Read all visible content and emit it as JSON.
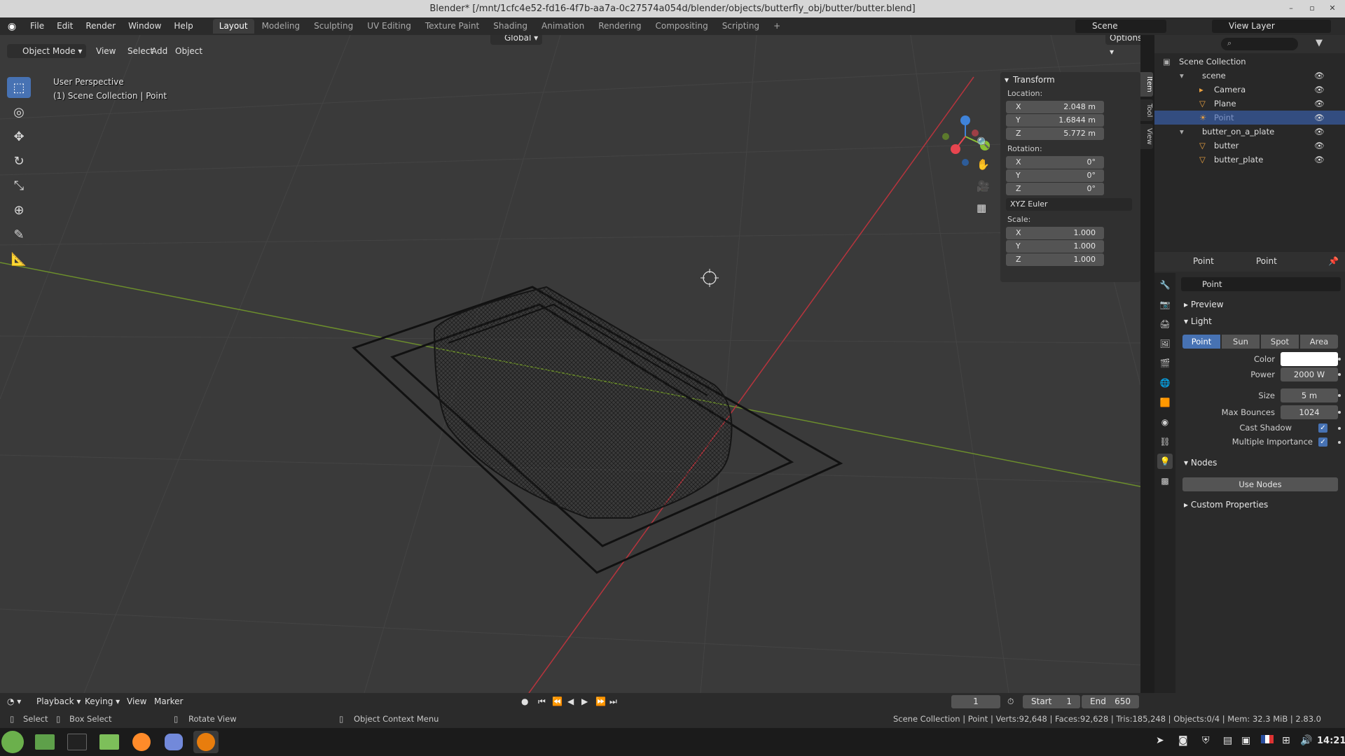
{
  "window": {
    "title": "Blender* [/mnt/1cfc4e52-fd16-4f7b-aa7a-0c27574a054d/blender/objects/butterfly_obj/butter/butter.blend]"
  },
  "menu": {
    "items": [
      "File",
      "Edit",
      "Render",
      "Window",
      "Help"
    ]
  },
  "workspaces": {
    "tabs": [
      "Layout",
      "Modeling",
      "Sculpting",
      "UV Editing",
      "Texture Paint",
      "Shading",
      "Animation",
      "Rendering",
      "Compositing",
      "Scripting"
    ],
    "active": "Layout",
    "add_label": "+"
  },
  "scene_selector": {
    "value": "Scene"
  },
  "view_layer_selector": {
    "value": "View Layer"
  },
  "viewport": {
    "mode": "Object Mode",
    "menus": [
      "View",
      "Select",
      "Add",
      "Object"
    ],
    "orientation": "Global",
    "options_label": "Options",
    "perspective_label": "User Perspective",
    "collection_label": "(1) Scene Collection | Point"
  },
  "transform_panel": {
    "title": "Transform",
    "location_label": "Location:",
    "location": {
      "x": "2.048 m",
      "y": "1.6844 m",
      "z": "5.772 m"
    },
    "rotation_label": "Rotation:",
    "rotation": {
      "x": "0°",
      "y": "0°",
      "z": "0°"
    },
    "rotation_mode": "XYZ Euler",
    "scale_label": "Scale:",
    "scale": {
      "x": "1.000",
      "y": "1.000",
      "z": "1.000"
    },
    "axis": {
      "x": "X",
      "y": "Y",
      "z": "Z"
    }
  },
  "sidebar_tabs": [
    "Item",
    "Tool",
    "View"
  ],
  "outliner": {
    "root": "Scene Collection",
    "rows": [
      {
        "label": "scene"
      },
      {
        "label": "Camera"
      },
      {
        "label": "Plane"
      },
      {
        "label": "Point"
      },
      {
        "label": "butter_on_a_plate"
      },
      {
        "label": "butter"
      },
      {
        "label": "butter_plate"
      }
    ]
  },
  "properties": {
    "header_left": "Point",
    "header_right": "Point",
    "datablock_name": "Point",
    "preview_label": "Preview",
    "light_label": "Light",
    "light_types": [
      "Point",
      "Sun",
      "Spot",
      "Area"
    ],
    "active_light_type": "Point",
    "color_label": "Color",
    "color_value": "#ffffff",
    "power_label": "Power",
    "power_value": "2000 W",
    "size_label": "Size",
    "size_value": "5 m",
    "max_bounces_label": "Max Bounces",
    "max_bounces_value": "1024",
    "cast_shadow_label": "Cast Shadow",
    "cast_shadow": true,
    "multiple_importance_label": "Multiple Importance",
    "multiple_importance": true,
    "nodes_label": "Nodes",
    "use_nodes_label": "Use Nodes",
    "custom_props_label": "Custom Properties"
  },
  "timeline": {
    "menus": [
      "Playback",
      "Keying",
      "View",
      "Marker"
    ],
    "current_frame": "1",
    "start_label": "Start",
    "start_value": "1",
    "end_label": "End",
    "end_value": "650"
  },
  "statusbar": {
    "select": "Select",
    "box_select": "Box Select",
    "rotate_view": "Rotate View",
    "context_menu": "Object Context Menu",
    "stats": "Scene Collection | Point | Verts:92,648 | Faces:92,628 | Tris:185,248 | Objects:0/4 | Mem: 32.3 MiB | 2.83.0"
  },
  "taskbar": {
    "clock": "14:21"
  },
  "colors": {
    "accent": "#4772b3",
    "x_axis": "#e8454f",
    "y_axis": "#8ac034",
    "z_axis": "#3f83d9",
    "grid_bg": "#3a3a3a"
  }
}
